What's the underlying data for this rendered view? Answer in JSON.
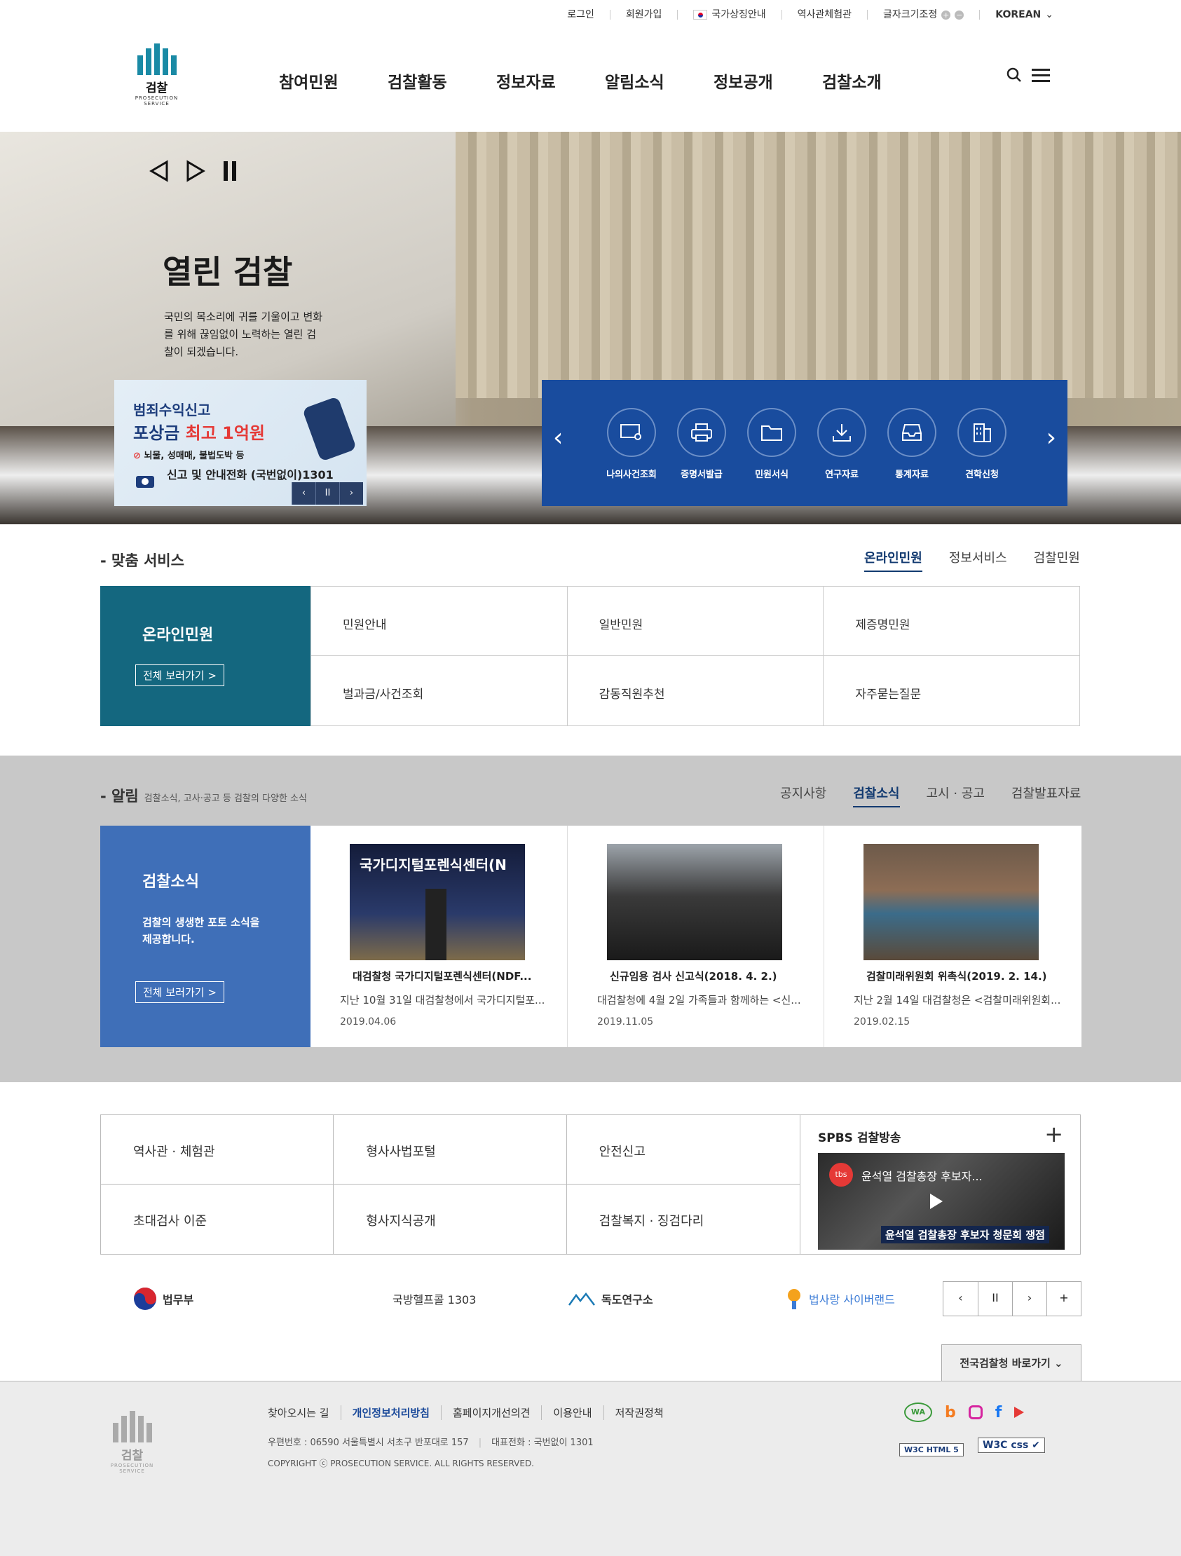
{
  "util": {
    "login": "로그인",
    "join": "회원가입",
    "symbol": "국가상징안내",
    "museum": "역사관체험관",
    "fontsize": "글자크기조정",
    "lang": "KOREAN"
  },
  "logo": {
    "name": "검찰",
    "sub": "PROSECUTION SERVICE"
  },
  "gnb": [
    "참여민원",
    "검찰활동",
    "정보자료",
    "알림소식",
    "정보공개",
    "검찰소개"
  ],
  "hero": {
    "title": "열린 검찰",
    "desc": "국민의 목소리에 귀를 기울이고 변화를 위해 끊임없이 노력하는 열린 검찰이 되겠습니다.",
    "banner": {
      "l1": "범죄수익신고",
      "l2a": "포상금 ",
      "l2b": "최고 1억원",
      "l3": "뇌물, 성매매, 불법도박 등",
      "l4": "신고 및 안내전화 (국번없이)1301"
    },
    "quick": [
      "나의사건조회",
      "증명서발급",
      "민원서식",
      "연구자료",
      "통계자료",
      "견학신청"
    ]
  },
  "service": {
    "title": "- 맞춤 서비스",
    "tabs": [
      "온라인민원",
      "정보서비스",
      "검찰민원"
    ],
    "left_title": "온라인민원",
    "view_all": "전체 보러가기 >",
    "items": [
      "민원안내",
      "일반민원",
      "제증명민원",
      "벌과금/사건조회",
      "감동직원추천",
      "자주묻는질문"
    ]
  },
  "news": {
    "title": "- 알림",
    "sub": "검찰소식, 고사·공고 등 검찰의 다양한 소식",
    "tabs": [
      "공지사항",
      "검찰소식",
      "고시 · 공고",
      "검찰발표자료"
    ],
    "left_title": "검찰소식",
    "left_desc": "검찰의 생생한 포토 소식을 제공합니다.",
    "view_all": "전체 보러가기 >",
    "cards": [
      {
        "title": "대검찰청 국가디지털포렌식센터(NDF...",
        "desc": "지난 10월 31일 대검찰청에서 국가디지털포...",
        "date": "2019.04.06",
        "img_text": "국가디지털포렌식센터(N"
      },
      {
        "title": "신규임용 검사 신고식(2018. 4. 2.)",
        "desc": "대검찰청에 4월 2일 가족들과 함께하는 <신...",
        "date": "2019.11.05"
      },
      {
        "title": "검찰미래위원회 위촉식(2019. 2. 14.)",
        "desc": "지난 2월 14일 대검찰청은 <검찰미래위원회...",
        "date": "2019.02.15"
      }
    ]
  },
  "links": [
    "역사관 · 체험관",
    "형사사법포털",
    "안전신고",
    "초대검사 이준",
    "형사지식공개",
    "검찰복지 · 징검다리"
  ],
  "spbs": {
    "title": "SPBS 검찰방송",
    "video_title": "윤석열 검찰총장 후보자...",
    "video_caption": "윤석열 검찰총장 후보자 청문회 쟁점"
  },
  "partners": [
    "법무부",
    "국방헬프콜 1303",
    "독도연구소",
    "법사랑 사이버랜드"
  ],
  "select_label": "전국검찰청 바로가기",
  "footer": {
    "links": [
      "찾아오시는 길",
      "개인정보처리방침",
      "홈페이지개선의견",
      "이용안내",
      "저작권정책"
    ],
    "address": "우편번호 : 06590 서울특별시 서초구 반포대로 157",
    "tel": "대표전화 : 국번없이 1301",
    "copy": "COPYRIGHT ⓒ PROSECUTION SERVICE. ALL RIGHTS RESERVED."
  },
  "colors": {
    "teal": "#14677f",
    "blue": "#3f6fb8",
    "navy": "#194c9e"
  }
}
